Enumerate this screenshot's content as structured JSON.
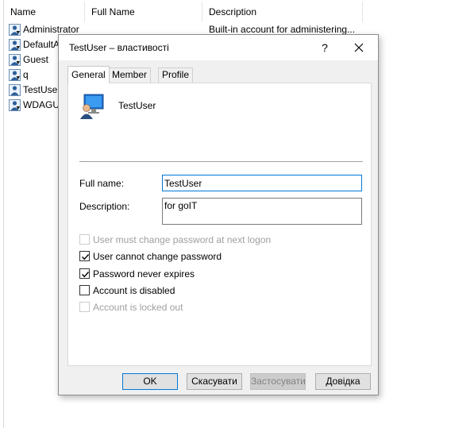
{
  "listview": {
    "columns": [
      "Name",
      "Full Name",
      "Description"
    ],
    "rows": [
      {
        "name": "Administrator",
        "full_name": "",
        "description": "Built-in account for administering..."
      },
      {
        "name": "DefaultAc",
        "full_name": "",
        "description": ""
      },
      {
        "name": "Guest",
        "full_name": "",
        "description": ""
      },
      {
        "name": "q",
        "full_name": "",
        "description": ""
      },
      {
        "name": "TestUser",
        "full_name": "",
        "description": ""
      },
      {
        "name": "WDAGUti",
        "full_name": "",
        "description": ""
      }
    ]
  },
  "dialog": {
    "title": "TestUser – властивості",
    "help_label": "?",
    "tabs": [
      {
        "label": "General",
        "active": true
      },
      {
        "label": "Member Of",
        "active": false
      },
      {
        "label": "Profile",
        "active": false
      }
    ],
    "general": {
      "user_name": "TestUser",
      "full_name_label": "Full name:",
      "full_name_value": "TestUser",
      "description_label": "Description:",
      "description_value": "for goIT",
      "checkboxes": [
        {
          "label": "User must change password at next logon",
          "checked": false,
          "enabled": false
        },
        {
          "label": "User cannot change password",
          "checked": true,
          "enabled": true
        },
        {
          "label": "Password never expires",
          "checked": true,
          "enabled": true
        },
        {
          "label": "Account is disabled",
          "checked": false,
          "enabled": true
        },
        {
          "label": "Account is locked out",
          "checked": false,
          "enabled": false
        }
      ]
    },
    "buttons": {
      "ok": "OK",
      "cancel": "Скасувати",
      "apply": "Застосувати",
      "help": "Довідка"
    }
  },
  "colors": {
    "accent": "#0078d7",
    "dialog_bg": "#f0f0f0",
    "disabled_text": "#a0a0a0"
  },
  "icons": {
    "user_list_icon": "user-account-icon",
    "user_big_icon": "user-account-icon",
    "close": "close-icon",
    "check": "checkmark-icon"
  }
}
